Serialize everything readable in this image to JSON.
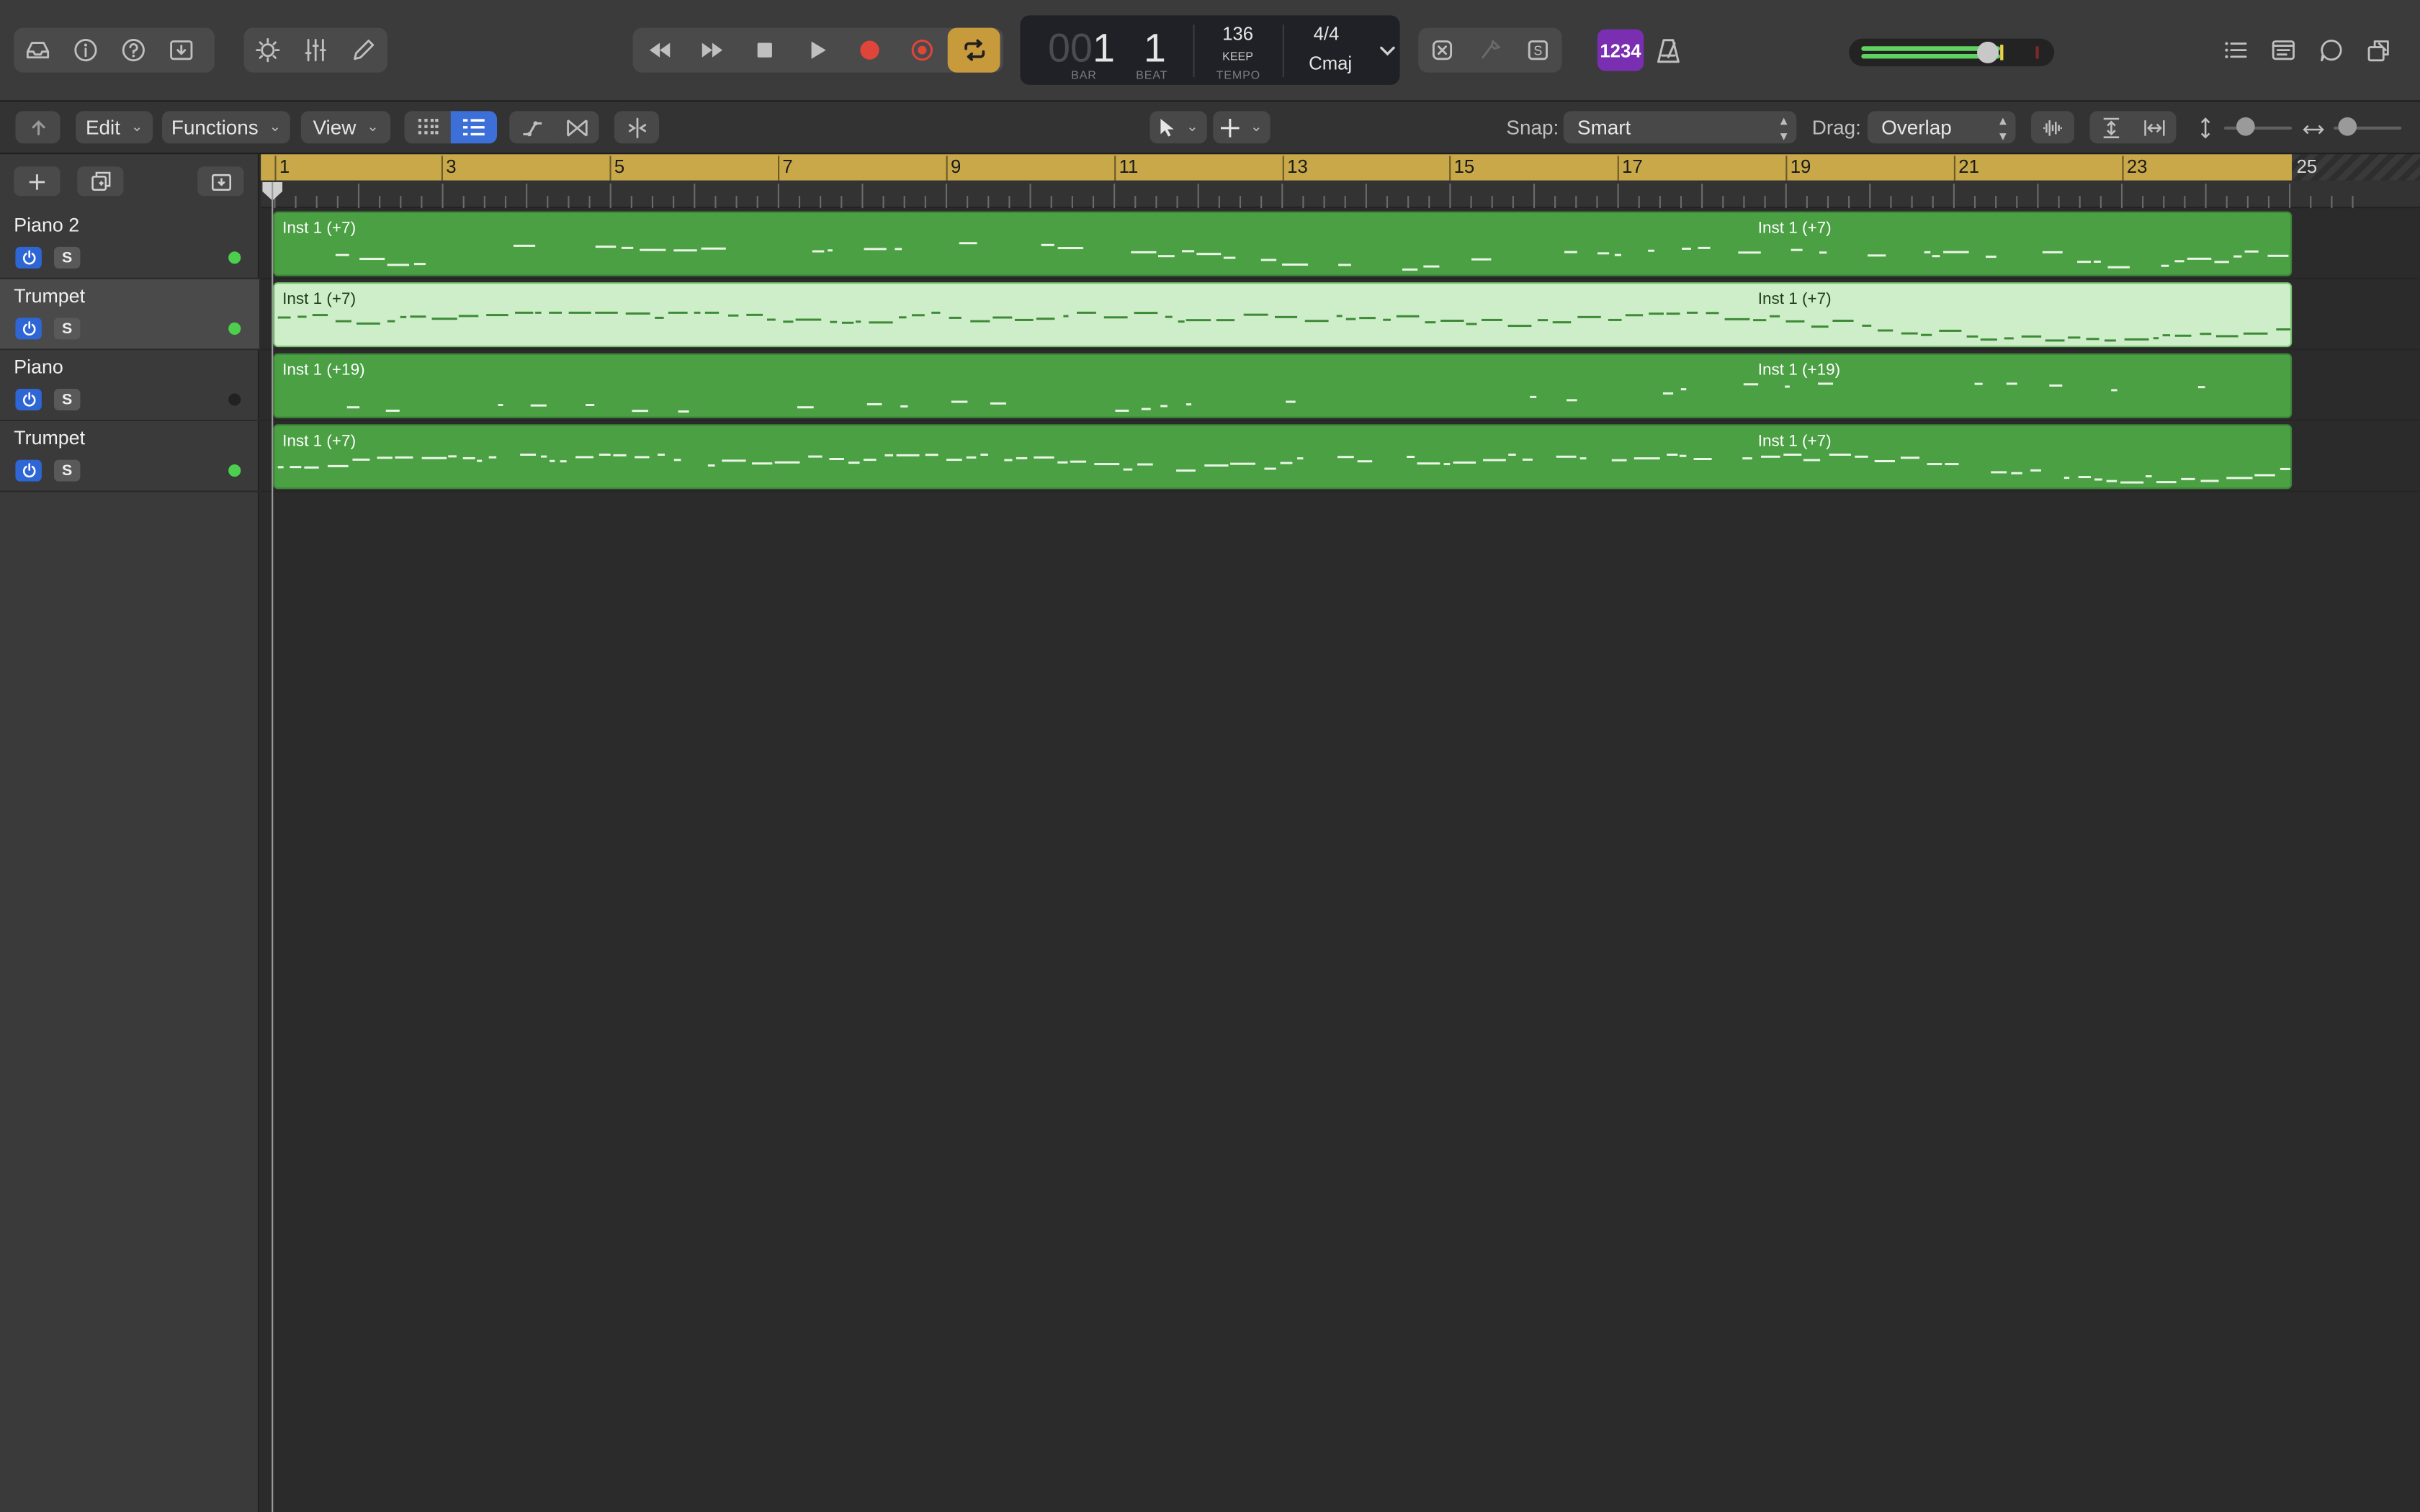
{
  "control_bar": {
    "left_icons": [
      "library-icon",
      "info-icon",
      "help-icon",
      "download-icon"
    ],
    "mid_icons": [
      "brightness-icon",
      "mixer-icon",
      "pencil-icon"
    ],
    "transport_icons": [
      "rewind-icon",
      "fast-forward-icon",
      "stop-icon",
      "play-icon",
      "record-icon",
      "capture-record-icon",
      "cycle-icon"
    ],
    "lcd": {
      "bar_prefix": "00",
      "bar": "1",
      "beat": "1",
      "bar_caption": "BAR",
      "beat_caption": "BEAT",
      "tempo": "136",
      "tempo_mode": "KEEP",
      "tempo_caption": "TEMPO",
      "time_signature": "4/4",
      "key": "Cmaj"
    },
    "count_in_badge": "1234",
    "right_icons": [
      "list-editors-icon",
      "note-pad-icon",
      "loop-browser-icon",
      "media-browser-icon"
    ]
  },
  "toolbar": {
    "menus": [
      "Edit",
      "Functions",
      "View"
    ],
    "snap_label": "Snap:",
    "snap_value": "Smart",
    "drag_label": "Drag:",
    "drag_value": "Overlap"
  },
  "tracks": [
    {
      "name": "Piano 2",
      "solo": "S",
      "led": "#4ccf4c",
      "selected": false
    },
    {
      "name": "Trumpet",
      "solo": "S",
      "led": "#4ccf4c",
      "selected": true
    },
    {
      "name": "Piano",
      "solo": "S",
      "led": "#2a2a2a",
      "selected": false
    },
    {
      "name": "Trumpet",
      "solo": "S",
      "led": "#4ccf4c",
      "selected": false
    }
  ],
  "ruler": {
    "bars": [
      "1",
      "3",
      "5",
      "7",
      "9",
      "11",
      "13",
      "15",
      "17",
      "19",
      "21",
      "23",
      "25"
    ],
    "cycle_color": "#c9a849"
  },
  "regions": [
    {
      "label_a": "Inst 1 (+7)",
      "label_b": "Inst 1 (+7)",
      "selected": false
    },
    {
      "label_a": "Inst 1 (+7)",
      "label_b": "Inst 1 (+7)",
      "selected": true
    },
    {
      "label_a": "Inst 1 (+19)",
      "label_b": "Inst 1 (+19)",
      "selected": false
    },
    {
      "label_a": "Inst 1 (+7)",
      "label_b": "Inst 1 (+7)",
      "selected": false
    }
  ],
  "colors": {
    "region_green": "#4aa043",
    "region_selected": "#cdeec8",
    "accent_blue": "#2f66d6",
    "cycle_orange": "#c79a3c",
    "record_red": "#e0453a",
    "badge_purple": "#7a2fb2"
  }
}
